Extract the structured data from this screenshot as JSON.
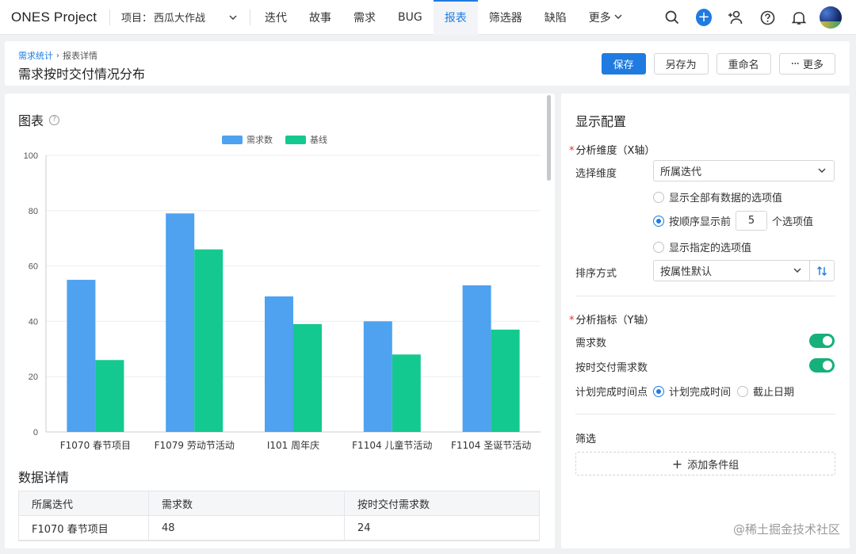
{
  "topbar": {
    "brand": "ONES Project",
    "project_label": "项目：",
    "project_value": "西瓜大作战",
    "nav": [
      {
        "label": "迭代",
        "active": false
      },
      {
        "label": "故事",
        "active": false
      },
      {
        "label": "需求",
        "active": false
      },
      {
        "label": "BUG",
        "active": false
      },
      {
        "label": "报表",
        "active": true
      },
      {
        "label": "筛选器",
        "active": false
      },
      {
        "label": "缺陷",
        "active": false
      },
      {
        "label": "更多",
        "active": false
      }
    ],
    "icons": [
      "search-icon",
      "add-circle-icon",
      "add-user-icon",
      "help-icon",
      "bell-icon",
      "avatar"
    ]
  },
  "header": {
    "breadcrumb_link": "需求统计",
    "breadcrumb_current": "报表详情",
    "title": "需求按时交付情况分布",
    "buttons": {
      "save": "保存",
      "save_as": "另存为",
      "rename": "重命名",
      "more": "更多"
    }
  },
  "chart_section": {
    "title": "图表"
  },
  "chart_data": {
    "type": "bar",
    "categories": [
      "F1070 春节项目",
      "F1079 劳动节活动",
      "I101 周年庆",
      "F1104 儿童节活动",
      "F1104 圣诞节活动"
    ],
    "series": [
      {
        "name": "需求数",
        "values": [
          55,
          79,
          49,
          40,
          53
        ],
        "color": "#4ea2ef"
      },
      {
        "name": "基线",
        "values": [
          26,
          66,
          39,
          28,
          37
        ],
        "color": "#14c98f"
      }
    ],
    "yticks": [
      0,
      20,
      40,
      60,
      80,
      100
    ],
    "ylim": [
      0,
      100
    ],
    "grid": true,
    "legend": "top-center"
  },
  "detail_section": {
    "title": "数据详情",
    "columns": [
      "所属迭代",
      "需求数",
      "按时交付需求数"
    ],
    "rows": [
      [
        "F1070  春节项目",
        "48",
        "24"
      ]
    ]
  },
  "config": {
    "title": "显示配置",
    "x_axis_title": "分析维度（X轴）",
    "dimension_label": "选择维度",
    "dimension_value": "所属迭代",
    "radio_all": "显示全部有数据的选项值",
    "radio_top_prefix": "按顺序显示前",
    "radio_top_value": "5",
    "radio_top_suffix": "个选项值",
    "radio_specified": "显示指定的选项值",
    "sort_label": "排序方式",
    "sort_value": "按属性默认",
    "y_axis_title": "分析指标（Y轴）",
    "metric_1": "需求数",
    "metric_2": "按时交付需求数",
    "time_point_label": "计划完成时间点",
    "time_option_1": "计划完成时间",
    "time_option_2": "截止日期",
    "filter_title": "筛选",
    "add_group": "添加条件组"
  },
  "watermark": "@稀土掘金技术社区"
}
